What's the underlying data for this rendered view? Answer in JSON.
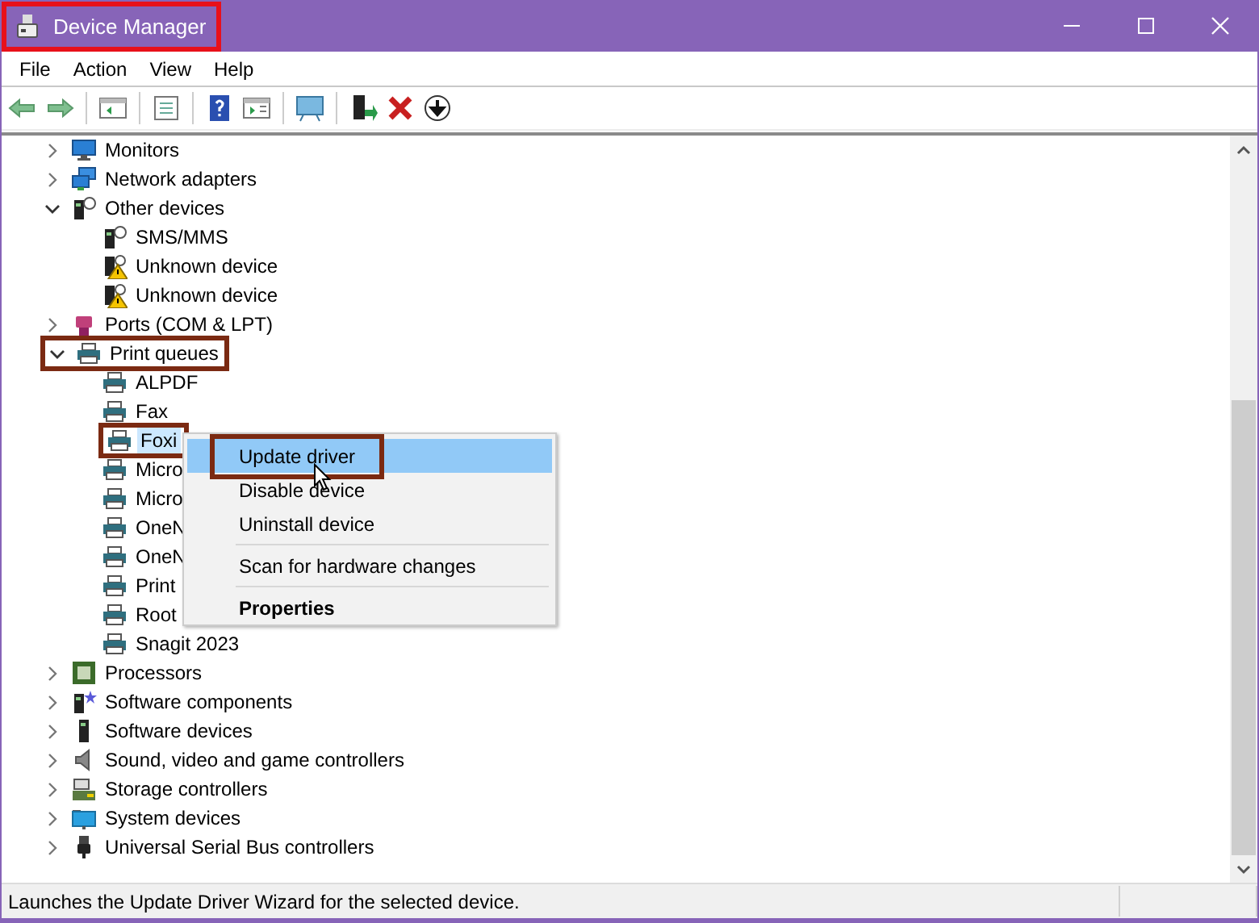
{
  "window": {
    "title": "Device Manager",
    "outlined": true
  },
  "menu_bar": [
    "File",
    "Action",
    "View",
    "Help"
  ],
  "tree": [
    {
      "label": "Monitors",
      "kind": "monitor",
      "expanded": false,
      "selected": false,
      "outlined": false
    },
    {
      "label": "Network adapters",
      "kind": "network",
      "expanded": false,
      "selected": false,
      "outlined": false
    },
    {
      "label": "Other devices",
      "kind": "unknown",
      "expanded": true,
      "selected": false,
      "outlined": false,
      "children": [
        {
          "label": "SMS/MMS",
          "kind": "unknown",
          "selected": false,
          "outlined": false
        },
        {
          "label": "Unknown device",
          "kind": "warning",
          "selected": false,
          "outlined": false
        },
        {
          "label": "Unknown device",
          "kind": "warning",
          "selected": false,
          "outlined": false
        }
      ]
    },
    {
      "label": "Ports (COM & LPT)",
      "kind": "port",
      "expanded": false,
      "selected": false,
      "outlined": false
    },
    {
      "label": "Print queues",
      "kind": "printer",
      "expanded": true,
      "selected": false,
      "outlined": true,
      "children": [
        {
          "label": "ALPDF",
          "kind": "printer",
          "selected": false,
          "outlined": false
        },
        {
          "label": "Fax",
          "kind": "printer",
          "selected": false,
          "outlined": false
        },
        {
          "label": "Foxi",
          "kind": "printer",
          "selected": true,
          "outlined": true
        },
        {
          "label": "Micro",
          "kind": "printer",
          "selected": false,
          "outlined": false
        },
        {
          "label": "Micro",
          "kind": "printer",
          "selected": false,
          "outlined": false
        },
        {
          "label": "OneN",
          "kind": "printer",
          "selected": false,
          "outlined": false
        },
        {
          "label": "OneN",
          "kind": "printer",
          "selected": false,
          "outlined": false
        },
        {
          "label": "Print",
          "kind": "printer",
          "selected": false,
          "outlined": false
        },
        {
          "label": "Root",
          "kind": "printer",
          "selected": false,
          "outlined": false
        },
        {
          "label": "Snagit 2023",
          "kind": "printer",
          "selected": false,
          "outlined": false
        }
      ]
    },
    {
      "label": "Processors",
      "kind": "processor",
      "expanded": false,
      "selected": false,
      "outlined": false
    },
    {
      "label": "Software components",
      "kind": "component",
      "expanded": false,
      "selected": false,
      "outlined": false
    },
    {
      "label": "Software devices",
      "kind": "tower",
      "expanded": false,
      "selected": false,
      "outlined": false
    },
    {
      "label": "Sound, video and game controllers",
      "kind": "sound",
      "expanded": false,
      "selected": false,
      "outlined": false
    },
    {
      "label": "Storage controllers",
      "kind": "storage",
      "expanded": false,
      "selected": false,
      "outlined": false
    },
    {
      "label": "System devices",
      "kind": "system",
      "expanded": false,
      "selected": false,
      "outlined": false
    },
    {
      "label": "Universal Serial Bus controllers",
      "kind": "usb",
      "expanded": false,
      "selected": false,
      "outlined": false
    }
  ],
  "context_menu": [
    {
      "kind": "item",
      "label": "Update driver",
      "selected": true,
      "outlined": true,
      "default": false
    },
    {
      "kind": "item",
      "label": "Disable device",
      "selected": false,
      "outlined": false,
      "default": false
    },
    {
      "kind": "item",
      "label": "Uninstall device",
      "selected": false,
      "outlined": false,
      "default": false
    },
    {
      "kind": "separator"
    },
    {
      "kind": "item",
      "label": "Scan for hardware changes",
      "selected": false,
      "outlined": false,
      "default": false
    },
    {
      "kind": "separator"
    },
    {
      "kind": "item",
      "label": "Properties",
      "selected": false,
      "outlined": false,
      "default": true
    }
  ],
  "status_bar": "Launches the Update Driver Wizard for the selected device."
}
